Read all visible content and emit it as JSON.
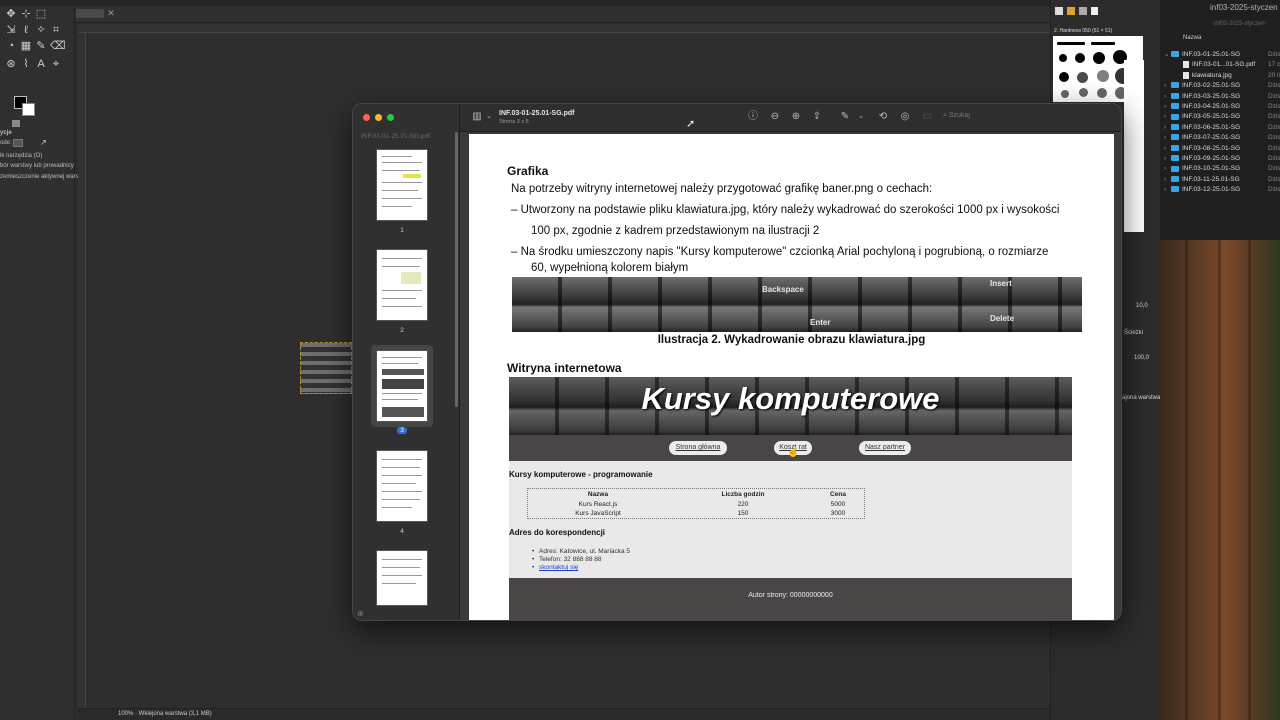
{
  "gimp": {
    "tab_label": "",
    "tool_options": {
      "title": "ycje",
      "line1": "ik narzędzia (O)",
      "mode_label": "ode:",
      "line2": "bór warstwy lub prowadnicy",
      "line3": "zemieszczenie aktywnej warstwy"
    },
    "status": "100% · Wklejona warstwa (3,1 MB)",
    "dock": {
      "brush_title": "2. Hardness 050 (51 × 51)",
      "spacing": "10,0",
      "opacity_label": "Ścieżki",
      "zoom": "100,0",
      "layer_label": "ajona warstwa"
    }
  },
  "finder": {
    "title": "inf03-2025-styczen",
    "subtitle": "inf03-2025-styczen",
    "column_name": "Nazwa",
    "rows": [
      {
        "name": "INF.03-01-25.01-SG",
        "meta": "Dzis",
        "kind": "folder",
        "open": true
      },
      {
        "name": "INF.03-01...01-SG.pdf",
        "meta": "17 c",
        "kind": "file"
      },
      {
        "name": "klawiatura.jpg",
        "meta": "20 li",
        "kind": "file"
      },
      {
        "name": "INF.03-02-25.01-SG",
        "meta": "Dzis",
        "kind": "folder"
      },
      {
        "name": "INF.03-03-25.01-SG",
        "meta": "Dzis",
        "kind": "folder"
      },
      {
        "name": "INF.03-04-25.01-SG",
        "meta": "Dzis",
        "kind": "folder"
      },
      {
        "name": "INF.03-05-25.01-SG",
        "meta": "Dzis",
        "kind": "folder"
      },
      {
        "name": "INF.03-06-25.01-SG",
        "meta": "Dzis",
        "kind": "folder"
      },
      {
        "name": "INF.03-07-25.01-SG",
        "meta": "Dzis",
        "kind": "folder"
      },
      {
        "name": "INF.03-08-25.01-SG",
        "meta": "Dzis",
        "kind": "folder"
      },
      {
        "name": "INF.03-09-25.01-SG",
        "meta": "Dzis",
        "kind": "folder"
      },
      {
        "name": "INF.03-10-25.01-SG",
        "meta": "Dzis",
        "kind": "folder"
      },
      {
        "name": "INF.03-11-25.01-SG",
        "meta": "Dzis",
        "kind": "folder"
      },
      {
        "name": "INF.03-12-25.01-SG",
        "meta": "Dzis",
        "kind": "folder"
      }
    ]
  },
  "preview": {
    "sidebar_title": "INF.03-01-25.01-SG.pdf",
    "filename": "INF.03-01-25.01-SG.pdf",
    "page_info": "Strona 3 z 6",
    "search_placeholder": "Szukaj",
    "thumbnails": [
      {
        "num": "1"
      },
      {
        "num": "2"
      },
      {
        "num": "3",
        "selected": true
      },
      {
        "num": "4"
      },
      {
        "num": ""
      }
    ]
  },
  "document": {
    "heading_graphics": "Grafika",
    "intro": "Na potrzeby witryny internetowej należy przygotować grafikę baner.png o cechach:",
    "bullet1_line1": "– Utworzony na podstawie pliku klawiatura.jpg, który należy wykadrować do szerokości 1000 px i wysokości",
    "bullet1_line2": "100 px, zgodnie z kadrem przedstawionym na ilustracji 2",
    "bullet2_line1": "– Na środku umieszczony napis \"Kursy komputerowe\" czcionką Arial pochyloną i pogrubioną, o rozmiarze",
    "bullet2_line2": "60, wypełnioną kolorem białym",
    "keyboard_labels": {
      "backspace": "Backspace",
      "insert": "Insert",
      "enter": "Enter",
      "delete": "Delete"
    },
    "caption": "Ilustracja 2. Wykadrowanie obrazu klawiatura.jpg",
    "heading_site": "Witryna internetowa"
  },
  "site": {
    "banner_text": "Kursy komputerowe",
    "nav": [
      "Strona główna",
      "Koszt rat",
      "Nasz partner"
    ],
    "section1_title": "Kursy komputerowe - programowanie",
    "table": {
      "headers": [
        "Nazwa",
        "Liczba godzin",
        "Cena"
      ],
      "rows": [
        [
          "Kurs React.js",
          "220",
          "5000"
        ],
        [
          "Kurs JavaScript",
          "150",
          "3000"
        ]
      ]
    },
    "section2_title": "Adres do korespondencji",
    "address": [
      "Adres: Katowice, ul. Mariacka 5",
      "Telefon: 32 888 88 88",
      "skontaktuj się"
    ],
    "footer": "Autor strony: 00000000000"
  }
}
